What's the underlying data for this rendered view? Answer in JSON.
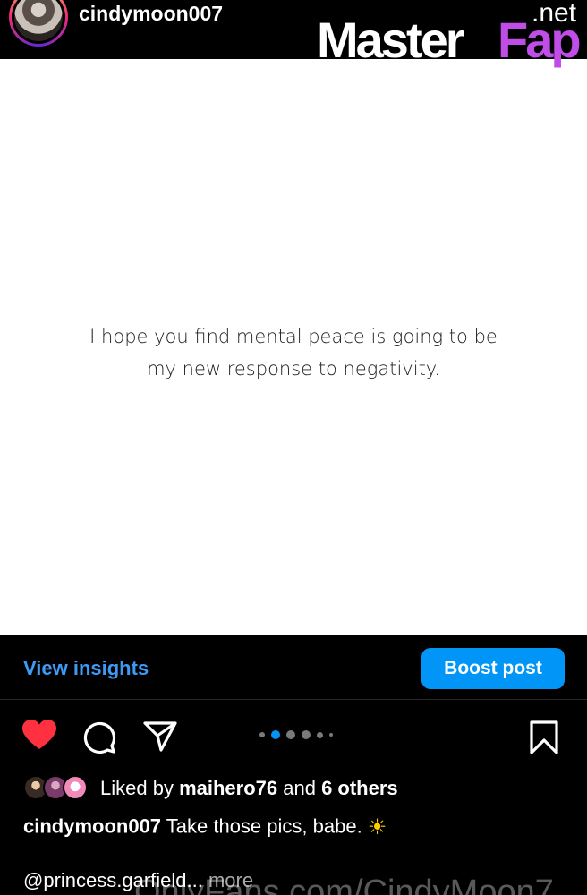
{
  "header": {
    "username": "cindymoon007"
  },
  "watermark": {
    "brand_left": "Master",
    "brand_right": "Fap",
    "tld": ".net",
    "bottom": "OnlyFans.com/CindyMoon7"
  },
  "post": {
    "quote_line1": "I hope you find mental peace is going to be",
    "quote_line2": "my new response to negativity."
  },
  "insights": {
    "view_label": "View insights",
    "boost_label": "Boost post",
    "accent": "#0095f6"
  },
  "actions": {
    "icons": [
      "heart-icon",
      "comment-icon",
      "share-icon",
      "bookmark-icon"
    ],
    "carousel_count": 6,
    "carousel_active": 2
  },
  "likes": {
    "prefix": "Liked by ",
    "user": "maihero76",
    "middle": " and ",
    "others": "6 others"
  },
  "caption": {
    "user": "cindymoon007",
    "text": " Take those pics, babe.",
    "emoji": "☀"
  },
  "comment": {
    "mention": "@princess.garfield...",
    "more": " more"
  }
}
